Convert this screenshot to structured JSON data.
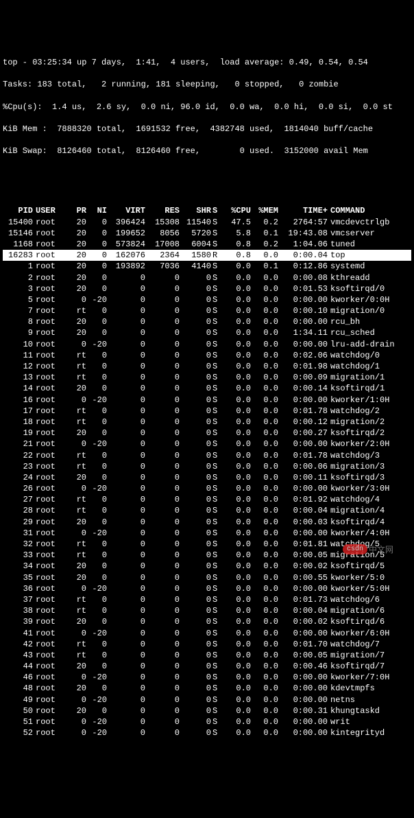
{
  "summary": {
    "l1": "top - 03:25:34 up 7 days,  1:41,  4 users,  load average: 0.49, 0.54, 0.54",
    "l2": "Tasks: 183 total,   2 running, 181 sleeping,   0 stopped,   0 zombie",
    "l3": "%Cpu(s):  1.4 us,  2.6 sy,  0.0 ni, 96.0 id,  0.0 wa,  0.0 hi,  0.0 si,  0.0 st",
    "l4": "KiB Mem :  7888320 total,  1691532 free,  4382748 used,  1814040 buff/cache",
    "l5": "KiB Swap:  8126460 total,  8126460 free,        0 used.  3152000 avail Mem"
  },
  "cols": [
    "PID",
    "USER",
    "PR",
    "NI",
    "VIRT",
    "RES",
    "SHR",
    "S",
    "%CPU",
    "%MEM",
    "TIME+",
    "COMMAND"
  ],
  "rows": [
    {
      "pid": "15400",
      "user": "root",
      "pr": "20",
      "ni": "0",
      "virt": "396424",
      "res": "15308",
      "shr": "11540",
      "s": "S",
      "cpu": "47.5",
      "mem": "0.2",
      "time": "2764:57",
      "cmd": "vmcdevctrlgb"
    },
    {
      "pid": "15146",
      "user": "root",
      "pr": "20",
      "ni": "0",
      "virt": "199652",
      "res": "8056",
      "shr": "5720",
      "s": "S",
      "cpu": "5.8",
      "mem": "0.1",
      "time": "19:43.08",
      "cmd": "vmcserver"
    },
    {
      "pid": "1168",
      "user": "root",
      "pr": "20",
      "ni": "0",
      "virt": "573824",
      "res": "17008",
      "shr": "6004",
      "s": "S",
      "cpu": "0.8",
      "mem": "0.2",
      "time": "1:04.06",
      "cmd": "tuned"
    },
    {
      "pid": "16283",
      "user": "root",
      "pr": "20",
      "ni": "0",
      "virt": "162076",
      "res": "2364",
      "shr": "1580",
      "s": "R",
      "cpu": "0.8",
      "mem": "0.0",
      "time": "0:00.04",
      "cmd": "top",
      "hl": true
    },
    {
      "pid": "1",
      "user": "root",
      "pr": "20",
      "ni": "0",
      "virt": "193892",
      "res": "7036",
      "shr": "4140",
      "s": "S",
      "cpu": "0.0",
      "mem": "0.1",
      "time": "0:12.86",
      "cmd": "systemd"
    },
    {
      "pid": "2",
      "user": "root",
      "pr": "20",
      "ni": "0",
      "virt": "0",
      "res": "0",
      "shr": "0",
      "s": "S",
      "cpu": "0.0",
      "mem": "0.0",
      "time": "0:00.08",
      "cmd": "kthreadd"
    },
    {
      "pid": "3",
      "user": "root",
      "pr": "20",
      "ni": "0",
      "virt": "0",
      "res": "0",
      "shr": "0",
      "s": "S",
      "cpu": "0.0",
      "mem": "0.0",
      "time": "0:01.53",
      "cmd": "ksoftirqd/0"
    },
    {
      "pid": "5",
      "user": "root",
      "pr": "0",
      "ni": "-20",
      "virt": "0",
      "res": "0",
      "shr": "0",
      "s": "S",
      "cpu": "0.0",
      "mem": "0.0",
      "time": "0:00.00",
      "cmd": "kworker/0:0H"
    },
    {
      "pid": "7",
      "user": "root",
      "pr": "rt",
      "ni": "0",
      "virt": "0",
      "res": "0",
      "shr": "0",
      "s": "S",
      "cpu": "0.0",
      "mem": "0.0",
      "time": "0:00.10",
      "cmd": "migration/0"
    },
    {
      "pid": "8",
      "user": "root",
      "pr": "20",
      "ni": "0",
      "virt": "0",
      "res": "0",
      "shr": "0",
      "s": "S",
      "cpu": "0.0",
      "mem": "0.0",
      "time": "0:00.00",
      "cmd": "rcu_bh"
    },
    {
      "pid": "9",
      "user": "root",
      "pr": "20",
      "ni": "0",
      "virt": "0",
      "res": "0",
      "shr": "0",
      "s": "S",
      "cpu": "0.0",
      "mem": "0.0",
      "time": "1:34.11",
      "cmd": "rcu_sched"
    },
    {
      "pid": "10",
      "user": "root",
      "pr": "0",
      "ni": "-20",
      "virt": "0",
      "res": "0",
      "shr": "0",
      "s": "S",
      "cpu": "0.0",
      "mem": "0.0",
      "time": "0:00.00",
      "cmd": "lru-add-drain"
    },
    {
      "pid": "11",
      "user": "root",
      "pr": "rt",
      "ni": "0",
      "virt": "0",
      "res": "0",
      "shr": "0",
      "s": "S",
      "cpu": "0.0",
      "mem": "0.0",
      "time": "0:02.06",
      "cmd": "watchdog/0"
    },
    {
      "pid": "12",
      "user": "root",
      "pr": "rt",
      "ni": "0",
      "virt": "0",
      "res": "0",
      "shr": "0",
      "s": "S",
      "cpu": "0.0",
      "mem": "0.0",
      "time": "0:01.98",
      "cmd": "watchdog/1"
    },
    {
      "pid": "13",
      "user": "root",
      "pr": "rt",
      "ni": "0",
      "virt": "0",
      "res": "0",
      "shr": "0",
      "s": "S",
      "cpu": "0.0",
      "mem": "0.0",
      "time": "0:00.09",
      "cmd": "migration/1"
    },
    {
      "pid": "14",
      "user": "root",
      "pr": "20",
      "ni": "0",
      "virt": "0",
      "res": "0",
      "shr": "0",
      "s": "S",
      "cpu": "0.0",
      "mem": "0.0",
      "time": "0:00.14",
      "cmd": "ksoftirqd/1"
    },
    {
      "pid": "16",
      "user": "root",
      "pr": "0",
      "ni": "-20",
      "virt": "0",
      "res": "0",
      "shr": "0",
      "s": "S",
      "cpu": "0.0",
      "mem": "0.0",
      "time": "0:00.00",
      "cmd": "kworker/1:0H"
    },
    {
      "pid": "17",
      "user": "root",
      "pr": "rt",
      "ni": "0",
      "virt": "0",
      "res": "0",
      "shr": "0",
      "s": "S",
      "cpu": "0.0",
      "mem": "0.0",
      "time": "0:01.78",
      "cmd": "watchdog/2"
    },
    {
      "pid": "18",
      "user": "root",
      "pr": "rt",
      "ni": "0",
      "virt": "0",
      "res": "0",
      "shr": "0",
      "s": "S",
      "cpu": "0.0",
      "mem": "0.0",
      "time": "0:00.12",
      "cmd": "migration/2"
    },
    {
      "pid": "19",
      "user": "root",
      "pr": "20",
      "ni": "0",
      "virt": "0",
      "res": "0",
      "shr": "0",
      "s": "S",
      "cpu": "0.0",
      "mem": "0.0",
      "time": "0:00.27",
      "cmd": "ksoftirqd/2"
    },
    {
      "pid": "21",
      "user": "root",
      "pr": "0",
      "ni": "-20",
      "virt": "0",
      "res": "0",
      "shr": "0",
      "s": "S",
      "cpu": "0.0",
      "mem": "0.0",
      "time": "0:00.00",
      "cmd": "kworker/2:0H"
    },
    {
      "pid": "22",
      "user": "root",
      "pr": "rt",
      "ni": "0",
      "virt": "0",
      "res": "0",
      "shr": "0",
      "s": "S",
      "cpu": "0.0",
      "mem": "0.0",
      "time": "0:01.78",
      "cmd": "watchdog/3"
    },
    {
      "pid": "23",
      "user": "root",
      "pr": "rt",
      "ni": "0",
      "virt": "0",
      "res": "0",
      "shr": "0",
      "s": "S",
      "cpu": "0.0",
      "mem": "0.0",
      "time": "0:00.06",
      "cmd": "migration/3"
    },
    {
      "pid": "24",
      "user": "root",
      "pr": "20",
      "ni": "0",
      "virt": "0",
      "res": "0",
      "shr": "0",
      "s": "S",
      "cpu": "0.0",
      "mem": "0.0",
      "time": "0:00.11",
      "cmd": "ksoftirqd/3"
    },
    {
      "pid": "26",
      "user": "root",
      "pr": "0",
      "ni": "-20",
      "virt": "0",
      "res": "0",
      "shr": "0",
      "s": "S",
      "cpu": "0.0",
      "mem": "0.0",
      "time": "0:00.00",
      "cmd": "kworker/3:0H"
    },
    {
      "pid": "27",
      "user": "root",
      "pr": "rt",
      "ni": "0",
      "virt": "0",
      "res": "0",
      "shr": "0",
      "s": "S",
      "cpu": "0.0",
      "mem": "0.0",
      "time": "0:01.92",
      "cmd": "watchdog/4"
    },
    {
      "pid": "28",
      "user": "root",
      "pr": "rt",
      "ni": "0",
      "virt": "0",
      "res": "0",
      "shr": "0",
      "s": "S",
      "cpu": "0.0",
      "mem": "0.0",
      "time": "0:00.04",
      "cmd": "migration/4"
    },
    {
      "pid": "29",
      "user": "root",
      "pr": "20",
      "ni": "0",
      "virt": "0",
      "res": "0",
      "shr": "0",
      "s": "S",
      "cpu": "0.0",
      "mem": "0.0",
      "time": "0:00.03",
      "cmd": "ksoftirqd/4"
    },
    {
      "pid": "31",
      "user": "root",
      "pr": "0",
      "ni": "-20",
      "virt": "0",
      "res": "0",
      "shr": "0",
      "s": "S",
      "cpu": "0.0",
      "mem": "0.0",
      "time": "0:00.00",
      "cmd": "kworker/4:0H"
    },
    {
      "pid": "32",
      "user": "root",
      "pr": "rt",
      "ni": "0",
      "virt": "0",
      "res": "0",
      "shr": "0",
      "s": "S",
      "cpu": "0.0",
      "mem": "0.0",
      "time": "0:01.81",
      "cmd": "watchdog/5"
    },
    {
      "pid": "33",
      "user": "root",
      "pr": "rt",
      "ni": "0",
      "virt": "0",
      "res": "0",
      "shr": "0",
      "s": "S",
      "cpu": "0.0",
      "mem": "0.0",
      "time": "0:00.05",
      "cmd": "migration/5"
    },
    {
      "pid": "34",
      "user": "root",
      "pr": "20",
      "ni": "0",
      "virt": "0",
      "res": "0",
      "shr": "0",
      "s": "S",
      "cpu": "0.0",
      "mem": "0.0",
      "time": "0:00.02",
      "cmd": "ksoftirqd/5"
    },
    {
      "pid": "35",
      "user": "root",
      "pr": "20",
      "ni": "0",
      "virt": "0",
      "res": "0",
      "shr": "0",
      "s": "S",
      "cpu": "0.0",
      "mem": "0.0",
      "time": "0:00.55",
      "cmd": "kworker/5:0"
    },
    {
      "pid": "36",
      "user": "root",
      "pr": "0",
      "ni": "-20",
      "virt": "0",
      "res": "0",
      "shr": "0",
      "s": "S",
      "cpu": "0.0",
      "mem": "0.0",
      "time": "0:00.00",
      "cmd": "kworker/5:0H"
    },
    {
      "pid": "37",
      "user": "root",
      "pr": "rt",
      "ni": "0",
      "virt": "0",
      "res": "0",
      "shr": "0",
      "s": "S",
      "cpu": "0.0",
      "mem": "0.0",
      "time": "0:01.73",
      "cmd": "watchdog/6"
    },
    {
      "pid": "38",
      "user": "root",
      "pr": "rt",
      "ni": "0",
      "virt": "0",
      "res": "0",
      "shr": "0",
      "s": "S",
      "cpu": "0.0",
      "mem": "0.0",
      "time": "0:00.04",
      "cmd": "migration/6"
    },
    {
      "pid": "39",
      "user": "root",
      "pr": "20",
      "ni": "0",
      "virt": "0",
      "res": "0",
      "shr": "0",
      "s": "S",
      "cpu": "0.0",
      "mem": "0.0",
      "time": "0:00.02",
      "cmd": "ksoftirqd/6"
    },
    {
      "pid": "41",
      "user": "root",
      "pr": "0",
      "ni": "-20",
      "virt": "0",
      "res": "0",
      "shr": "0",
      "s": "S",
      "cpu": "0.0",
      "mem": "0.0",
      "time": "0:00.00",
      "cmd": "kworker/6:0H"
    },
    {
      "pid": "42",
      "user": "root",
      "pr": "rt",
      "ni": "0",
      "virt": "0",
      "res": "0",
      "shr": "0",
      "s": "S",
      "cpu": "0.0",
      "mem": "0.0",
      "time": "0:01.70",
      "cmd": "watchdog/7"
    },
    {
      "pid": "43",
      "user": "root",
      "pr": "rt",
      "ni": "0",
      "virt": "0",
      "res": "0",
      "shr": "0",
      "s": "S",
      "cpu": "0.0",
      "mem": "0.0",
      "time": "0:00.05",
      "cmd": "migration/7"
    },
    {
      "pid": "44",
      "user": "root",
      "pr": "20",
      "ni": "0",
      "virt": "0",
      "res": "0",
      "shr": "0",
      "s": "S",
      "cpu": "0.0",
      "mem": "0.0",
      "time": "0:00.46",
      "cmd": "ksoftirqd/7"
    },
    {
      "pid": "46",
      "user": "root",
      "pr": "0",
      "ni": "-20",
      "virt": "0",
      "res": "0",
      "shr": "0",
      "s": "S",
      "cpu": "0.0",
      "mem": "0.0",
      "time": "0:00.00",
      "cmd": "kworker/7:0H"
    },
    {
      "pid": "48",
      "user": "root",
      "pr": "20",
      "ni": "0",
      "virt": "0",
      "res": "0",
      "shr": "0",
      "s": "S",
      "cpu": "0.0",
      "mem": "0.0",
      "time": "0:00.00",
      "cmd": "kdevtmpfs"
    },
    {
      "pid": "49",
      "user": "root",
      "pr": "0",
      "ni": "-20",
      "virt": "0",
      "res": "0",
      "shr": "0",
      "s": "S",
      "cpu": "0.0",
      "mem": "0.0",
      "time": "0:00.00",
      "cmd": "netns"
    },
    {
      "pid": "50",
      "user": "root",
      "pr": "20",
      "ni": "0",
      "virt": "0",
      "res": "0",
      "shr": "0",
      "s": "S",
      "cpu": "0.0",
      "mem": "0.0",
      "time": "0:00.31",
      "cmd": "khungtaskd"
    },
    {
      "pid": "51",
      "user": "root",
      "pr": "0",
      "ni": "-20",
      "virt": "0",
      "res": "0",
      "shr": "0",
      "s": "S",
      "cpu": "0.0",
      "mem": "0.0",
      "time": "0:00.00",
      "cmd": "writ"
    },
    {
      "pid": "52",
      "user": "root",
      "pr": "0",
      "ni": "-20",
      "virt": "0",
      "res": "0",
      "shr": "0",
      "s": "S",
      "cpu": "0.0",
      "mem": "0.0",
      "time": "0:00.00",
      "cmd": "kintegrityd"
    }
  ],
  "watermark": {
    "text": "中文网",
    "badge": "csdn"
  }
}
